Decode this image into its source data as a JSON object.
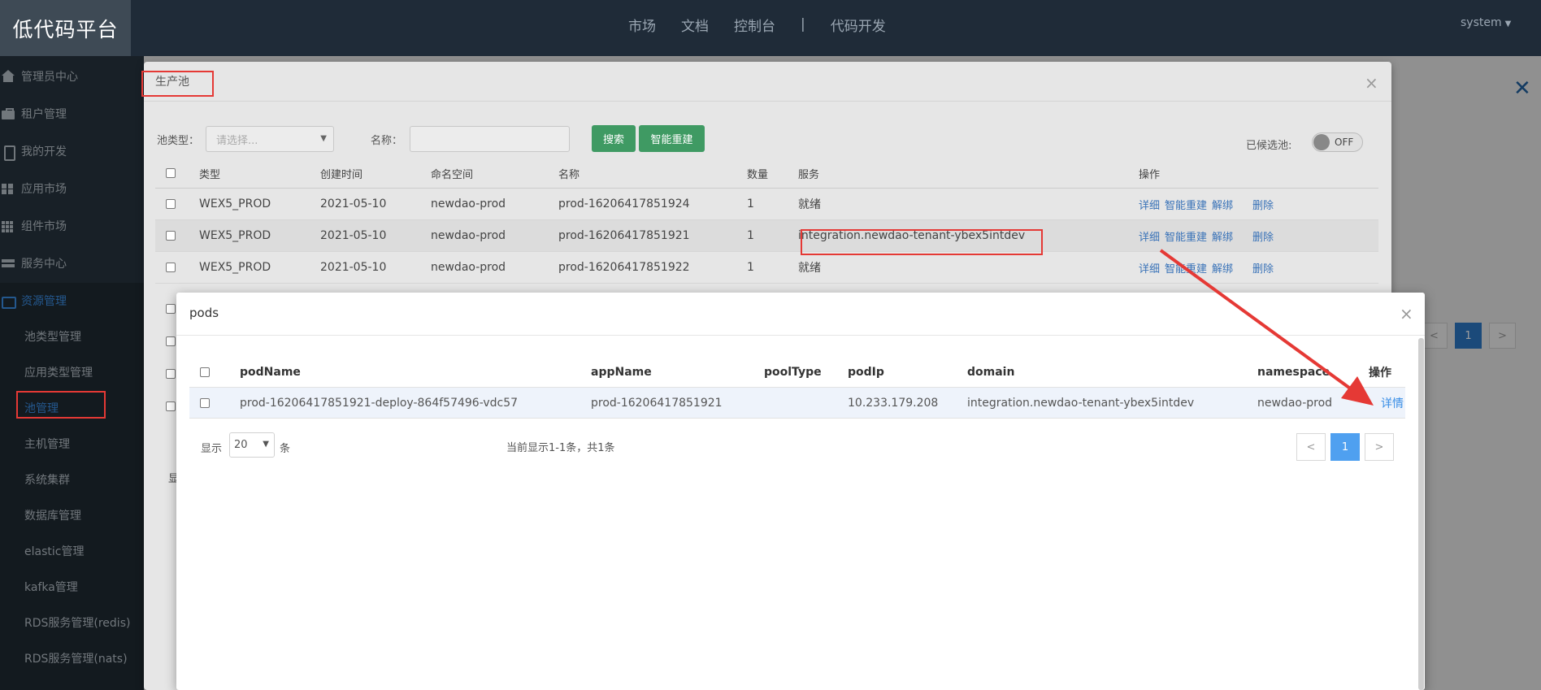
{
  "header": {
    "logo": "低代码平台",
    "nav": [
      "市场",
      "文档",
      "控制台",
      "代码开发"
    ],
    "separator": "|",
    "user": "system"
  },
  "sidebar": {
    "items": [
      {
        "label": "管理员中心",
        "icon": "home-icon"
      },
      {
        "label": "租户管理",
        "icon": "briefcase-icon"
      },
      {
        "label": "我的开发",
        "icon": "mobile-icon"
      },
      {
        "label": "应用市场",
        "icon": "grid-icon"
      },
      {
        "label": "组件市场",
        "icon": "grid9-icon"
      },
      {
        "label": "服务中心",
        "icon": "server-icon"
      },
      {
        "label": "资源管理",
        "icon": "hdd-icon"
      }
    ],
    "subitems": [
      "池类型管理",
      "应用类型管理",
      "池管理",
      "主机管理",
      "系统集群",
      "数据库管理",
      "elastic管理",
      "kafka管理",
      "RDS服务管理(redis)",
      "RDS服务管理(nats)"
    ],
    "active_sub": "池管理"
  },
  "background_page": {
    "pager_current": "1",
    "pager_prev": "<",
    "pager_next": ">"
  },
  "pool_modal": {
    "title": "生产池",
    "close": "×",
    "filter": {
      "pool_type_label": "池类型：",
      "pool_type_placeholder": "请选择...",
      "name_label": "名称：",
      "search_button": "搜索",
      "rebuild_button": "智能重建",
      "selected_label": "已候选池:",
      "switch_state": "OFF"
    },
    "columns": [
      "类型",
      "创建时间",
      "命名空间",
      "名称",
      "数量",
      "服务",
      "操作"
    ],
    "rows": [
      {
        "type": "WEX5_PROD",
        "created": "2021-05-10",
        "namespace": "newdao-prod",
        "name": "prod-16206417851924",
        "count": "1",
        "service": "就绪"
      },
      {
        "type": "WEX5_PROD",
        "created": "2021-05-10",
        "namespace": "newdao-prod",
        "name": "prod-16206417851921",
        "count": "1",
        "service": "integration.newdao-tenant-ybex5intdev"
      },
      {
        "type": "WEX5_PROD",
        "created": "2021-05-10",
        "namespace": "newdao-prod",
        "name": "prod-16206417851922",
        "count": "1",
        "service": "就绪"
      }
    ],
    "actions": [
      "详细",
      "智能重建",
      "解绑",
      "删除"
    ],
    "footer_fragment": "显"
  },
  "pods_modal": {
    "title": "pods",
    "close": "×",
    "columns": [
      "podName",
      "appName",
      "poolType",
      "podIp",
      "domain",
      "namespace",
      "操作"
    ],
    "rows": [
      {
        "podName": "prod-16206417851921-deploy-864f57496-vdc57",
        "appName": "prod-16206417851921",
        "poolType": "",
        "podIp": "10.233.179.208",
        "domain": "integration.newdao-tenant-ybex5intdev",
        "namespace": "newdao-prod",
        "action": "详情"
      }
    ],
    "footer": {
      "show_label": "显示",
      "page_size": "20",
      "unit_label": "条",
      "info": "当前显示1-1条，共1条",
      "prev": "<",
      "current": "1",
      "next": ">"
    }
  },
  "colors": {
    "header_bg": "#1f2b38",
    "sidebar_bg": "#283540",
    "accent_blue": "#3a8ee6",
    "green_button": "#3f9a63",
    "annotation_red": "#e53935"
  }
}
